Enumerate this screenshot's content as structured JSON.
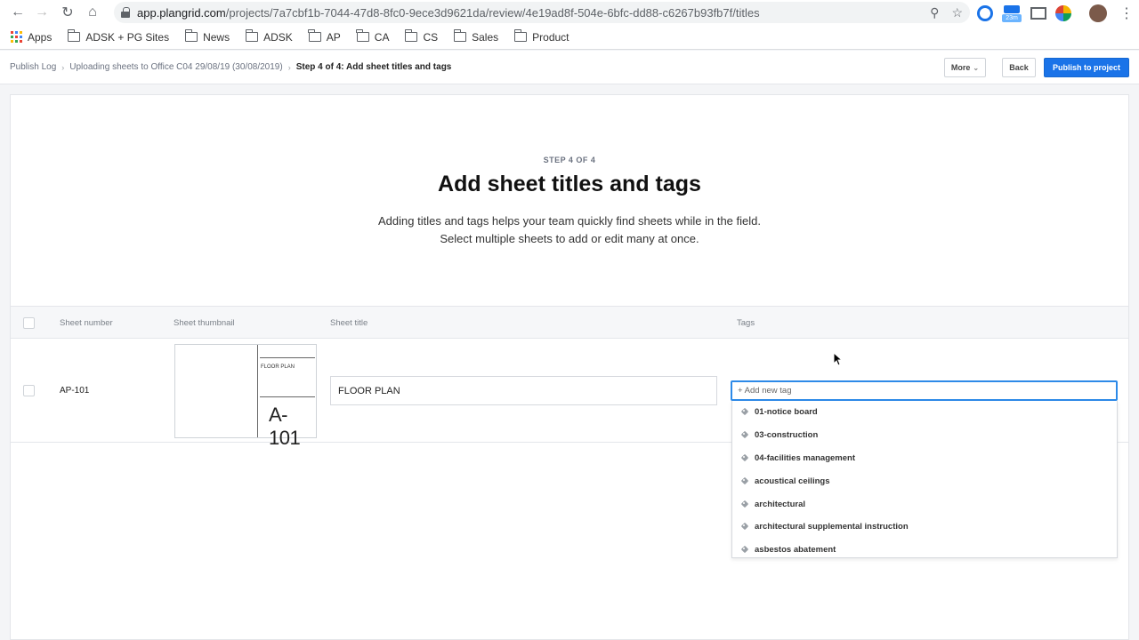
{
  "browser": {
    "url_host": "app.plangrid.com",
    "url_path": "/projects/7a7cbf1b-7044-47d8-8fc0-9ece3d9621da/review/4e19ad8f-504e-6bfc-dd88-c6267b93fb7f/titles",
    "extension_badge": "23m"
  },
  "bookmarks": {
    "apps": "Apps",
    "items": [
      "ADSK + PG Sites",
      "News",
      "ADSK",
      "AP",
      "CA",
      "CS",
      "Sales",
      "Product"
    ]
  },
  "header": {
    "breadcrumbs": [
      "Publish Log",
      "Uploading sheets to Office C04 29/08/19 (30/08/2019)",
      "Step 4 of 4: Add sheet titles and tags"
    ],
    "more_label": "More",
    "back_label": "Back",
    "publish_label": "Publish to project"
  },
  "hero": {
    "step": "STEP 4 OF 4",
    "title": "Add sheet titles and tags",
    "description": "Adding titles and tags helps your team quickly find sheets while in the field. Select multiple sheets to add or edit many at once."
  },
  "table": {
    "columns": {
      "number": "Sheet number",
      "thumbnail": "Sheet thumbnail",
      "title": "Sheet title",
      "tags": "Tags"
    },
    "row": {
      "number": "AP-101",
      "thumb_label": "FLOOR PLAN",
      "thumb_number": "A-101",
      "title_value": "FLOOR PLAN"
    }
  },
  "tags": {
    "placeholder": "+ Add new tag",
    "options": [
      "01-notice board",
      "03-construction",
      "04-facilities management",
      "acoustical ceilings",
      "architectural",
      "architectural supplemental instruction",
      "asbestos abatement"
    ]
  },
  "colors": {
    "accent": "#1a73e8",
    "focus": "#2d8ae8"
  }
}
